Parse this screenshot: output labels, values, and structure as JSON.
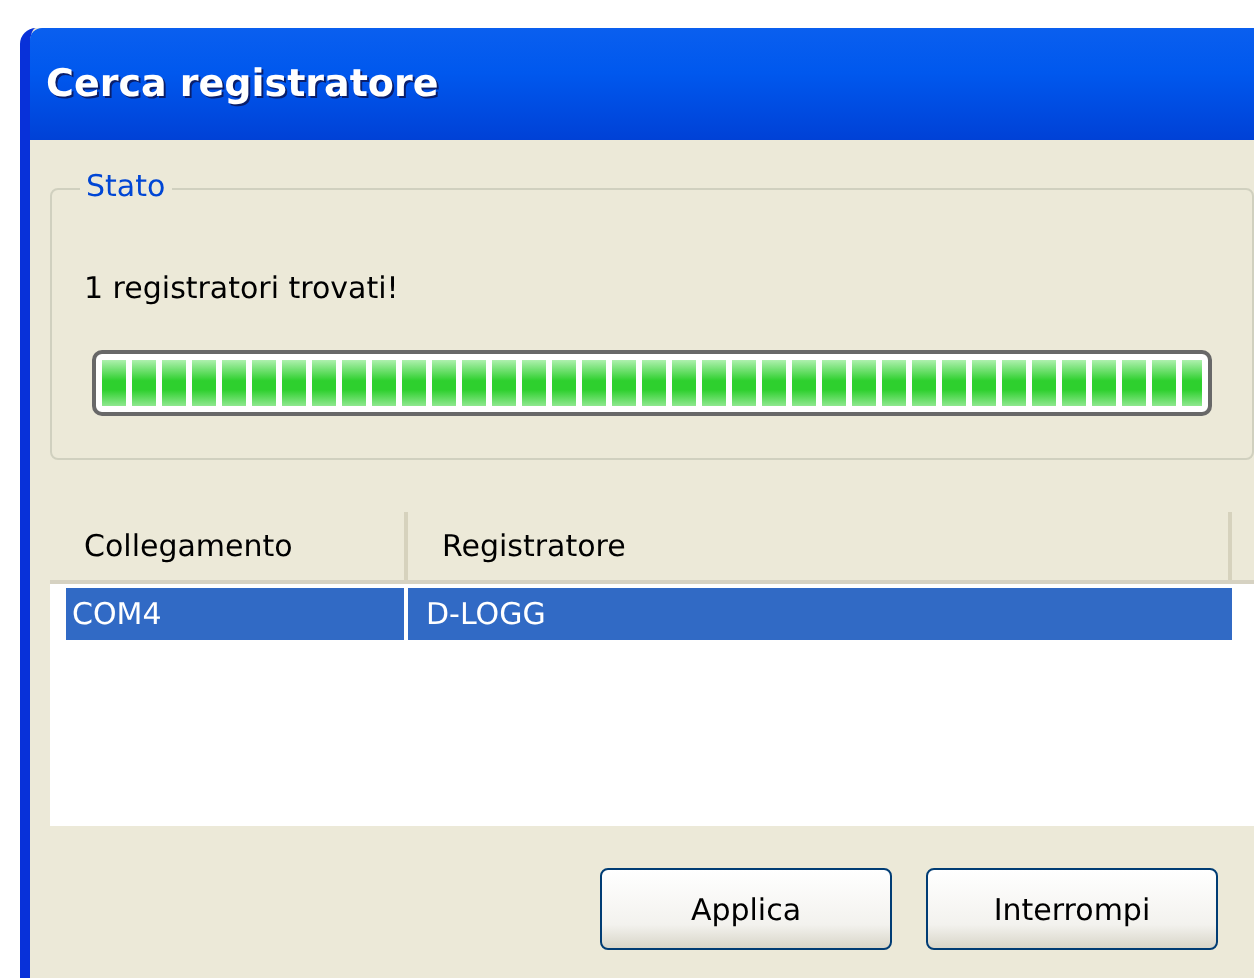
{
  "window": {
    "title": "Cerca registratore"
  },
  "status_group": {
    "title": "Stato",
    "message": "1 registratori trovati!",
    "progress": {
      "level": 1
    }
  },
  "table": {
    "columns": [
      "Collegamento",
      "Registratore"
    ],
    "rows": [
      {
        "cells": [
          "COM4",
          "D-LOGG"
        ],
        "selected": true
      }
    ]
  },
  "buttons": [
    "Applica",
    "Interrompi"
  ]
}
